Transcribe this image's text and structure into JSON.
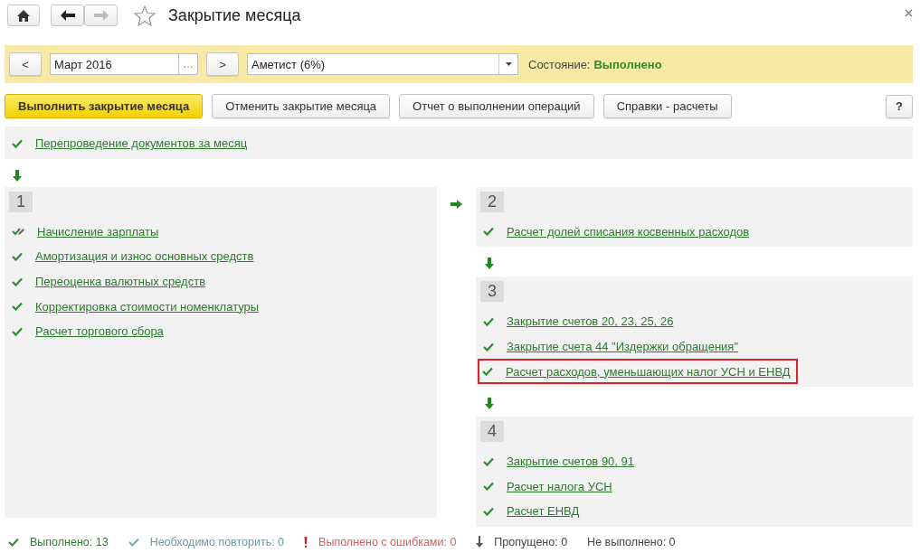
{
  "window": {
    "title": "Закрытие месяца"
  },
  "filter": {
    "prev": "<",
    "period": "Март 2016",
    "pick": "...",
    "next": ">",
    "organization": "Аметист (6%)",
    "state_label": "Состояние:",
    "state_value": "Выполнено"
  },
  "toolbar": [
    {
      "label": "Выполнить закрытие месяца",
      "kind": "primary"
    },
    {
      "label": "Отменить закрытие месяца",
      "kind": "normal"
    },
    {
      "label": "Отчет о выполнении операций",
      "kind": "normal"
    },
    {
      "label": "Справки - расчеты",
      "kind": "normal"
    }
  ],
  "help": "?",
  "repost": {
    "label": "Перепроведение документов за месяц",
    "kind": "done",
    "highlighted": false
  },
  "left_groups": [
    {
      "number": "1",
      "items": [
        {
          "label": "Начисление зарплаты",
          "kind": "edited",
          "highlighted": false
        },
        {
          "label": "Амортизация и износ основных средств",
          "kind": "done",
          "highlighted": false
        },
        {
          "label": "Переоценка валютных средств",
          "kind": "done",
          "highlighted": false
        },
        {
          "label": "Корректировка стоимости номенклатуры",
          "kind": "done",
          "highlighted": false
        },
        {
          "label": "Расчет торгового сбора",
          "kind": "done",
          "highlighted": false
        }
      ]
    }
  ],
  "right_groups": [
    {
      "number": "2",
      "items": [
        {
          "label": "Расчет долей списания косвенных расходов",
          "kind": "done",
          "highlighted": false
        }
      ]
    },
    {
      "number": "3",
      "items": [
        {
          "label": "Закрытие счетов 20, 23, 25, 26",
          "kind": "done",
          "highlighted": false
        },
        {
          "label": "Закрытие счета 44 \"Издержки обращения\"",
          "kind": "done",
          "highlighted": false
        },
        {
          "label": "Расчет расходов, уменьшающих налог УСН и ЕНВД",
          "kind": "done",
          "highlighted": true
        }
      ]
    },
    {
      "number": "4",
      "items": [
        {
          "label": "Закрытие счетов 90, 91",
          "kind": "done",
          "highlighted": false
        },
        {
          "label": "Расчет налога УСН",
          "kind": "done",
          "highlighted": false
        },
        {
          "label": "Расчет ЕНВД",
          "kind": "done",
          "highlighted": false
        }
      ]
    }
  ],
  "legend": [
    {
      "label": "Выполнено: 13",
      "kind": "done"
    },
    {
      "label": "Необходимо повторить: 0",
      "kind": "repeat"
    },
    {
      "label": "Выполнено с ошибками: 0",
      "kind": "error"
    },
    {
      "label": "Пропущено: 0",
      "kind": "skipped"
    },
    {
      "label": "Не выполнено: 0",
      "kind": "none"
    }
  ]
}
